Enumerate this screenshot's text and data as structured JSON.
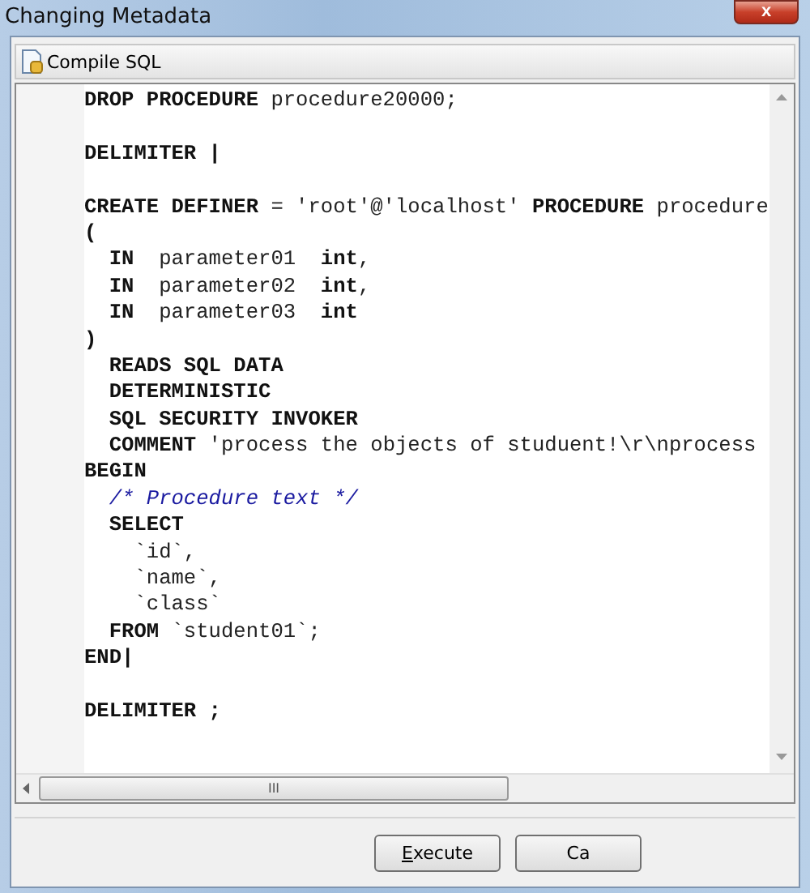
{
  "window": {
    "title": "Changing Metadata",
    "close_label": "x"
  },
  "toolbar": {
    "buttons": [
      {
        "label": "Compile SQL"
      }
    ]
  },
  "editor": {
    "lines": [
      {
        "kind": "code",
        "text": "**DROP PROCEDURE** procedure20000;"
      },
      {
        "kind": "blank"
      },
      {
        "kind": "code",
        "text": "**DELIMITER |**"
      },
      {
        "kind": "blank"
      },
      {
        "kind": "code",
        "text": "**CREATE DEFINER** = 'root'@'localhost' **PROCEDURE** procedure"
      },
      {
        "kind": "code",
        "text": "**(**"
      },
      {
        "kind": "code",
        "text": "  **IN**  parameter01  **int**,"
      },
      {
        "kind": "code",
        "text": "  **IN**  parameter02  **int**,"
      },
      {
        "kind": "code",
        "text": "  **IN**  parameter03  **int**"
      },
      {
        "kind": "code",
        "text": "**)**"
      },
      {
        "kind": "code",
        "text": "  **READS SQL DATA**"
      },
      {
        "kind": "code",
        "text": "  **DETERMINISTIC**"
      },
      {
        "kind": "code",
        "text": "  **SQL SECURITY INVOKER**"
      },
      {
        "kind": "code",
        "text": "  **COMMENT** 'process the objects of studuent!\\r\\nprocess"
      },
      {
        "kind": "code",
        "text": "**BEGIN**"
      },
      {
        "kind": "comment",
        "text": "  /* Procedure text */"
      },
      {
        "kind": "code",
        "text": "  **SELECT**"
      },
      {
        "kind": "code",
        "text": "    `id`,"
      },
      {
        "kind": "code",
        "text": "    `name`,"
      },
      {
        "kind": "code",
        "text": "    `class`"
      },
      {
        "kind": "code",
        "text": "  **FROM** `student01`;"
      },
      {
        "kind": "code",
        "text": "**END|**"
      },
      {
        "kind": "blank"
      },
      {
        "kind": "code",
        "text": "**DELIMITER ;**"
      }
    ],
    "scroll_grip": "III"
  },
  "buttons": [
    {
      "label": "Execute",
      "underline_first": true
    },
    {
      "label": "Ca"
    }
  ]
}
